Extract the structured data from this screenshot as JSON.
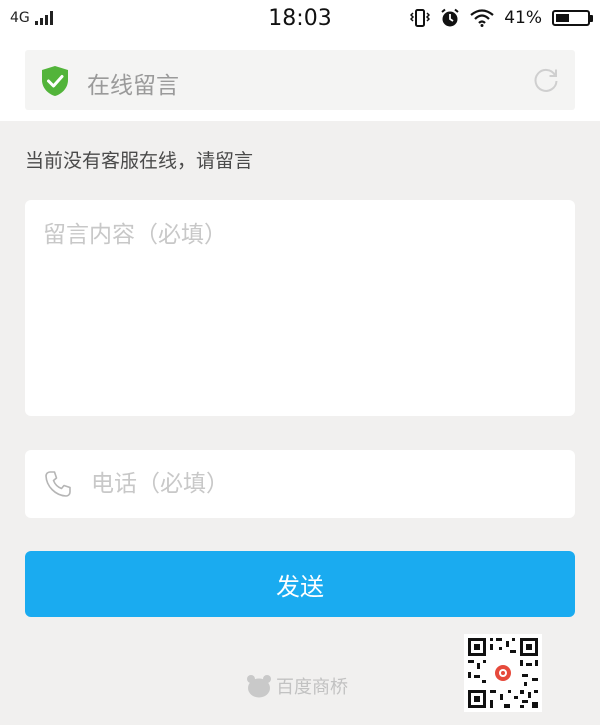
{
  "status_bar": {
    "network": "4G",
    "time": "18:03",
    "battery": "41%",
    "icons": [
      "signal-icon",
      "vibrate-icon",
      "alarm-icon",
      "wifi-icon",
      "battery-icon"
    ]
  },
  "header": {
    "title": "在线留言",
    "icons": [
      "shield-check-icon",
      "refresh-icon"
    ],
    "colors": {
      "shield": "#52b43a"
    }
  },
  "notice": "当前没有客服在线，请留言",
  "message_field": {
    "placeholder": "留言内容（必填）",
    "value": ""
  },
  "phone_field": {
    "placeholder": "电话（必填）",
    "value": "",
    "icon": "phone-icon"
  },
  "send_button": {
    "label": "发送",
    "color": "#1aabf0"
  },
  "footer": {
    "brand": "百度商桥",
    "icons": [
      "bear-logo-icon",
      "qr-code-icon"
    ]
  }
}
